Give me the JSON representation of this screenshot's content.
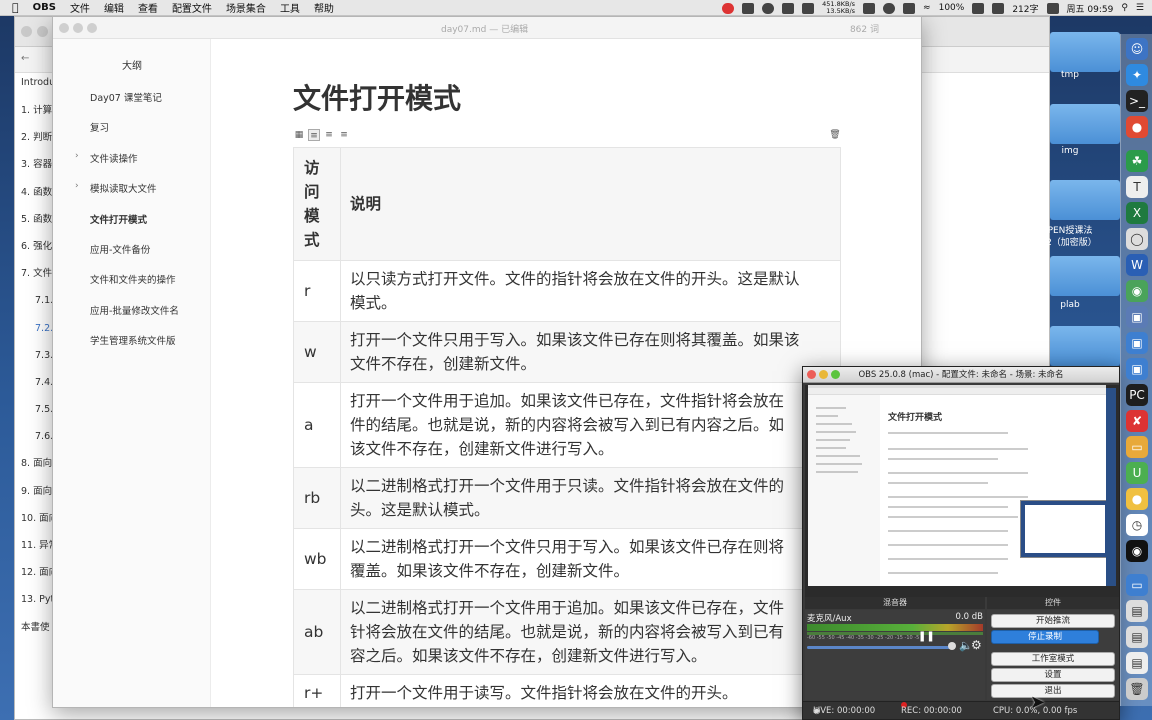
{
  "menubar": {
    "app_name": "OBS",
    "items": [
      "文件",
      "编辑",
      "查看",
      "配置文件",
      "场景集合",
      "工具",
      "帮助"
    ],
    "net_up": "451.8KB/s",
    "net_down": "13.5KB/s",
    "battery": "100%",
    "chars": "212字",
    "clock": "周五 09:59"
  },
  "back_window": {
    "intro": "Introdu",
    "nav": [
      {
        "label": "1. 计算",
        "sub": false,
        "active": false
      },
      {
        "label": "2. 判断",
        "sub": false,
        "active": false
      },
      {
        "label": "3. 容器",
        "sub": false,
        "active": false
      },
      {
        "label": "4. 函数",
        "sub": false,
        "active": false
      },
      {
        "label": "5. 函数",
        "sub": false,
        "active": false
      },
      {
        "label": "6. 强化",
        "sub": false,
        "active": false
      },
      {
        "label": "7. 文件",
        "sub": false,
        "active": false
      },
      {
        "label": "7.1.",
        "sub": true,
        "active": false
      },
      {
        "label": "7.2.",
        "sub": true,
        "active": true
      },
      {
        "label": "7.3.",
        "sub": true,
        "active": false
      },
      {
        "label": "7.4.",
        "sub": true,
        "active": false
      },
      {
        "label": "7.5.",
        "sub": true,
        "active": false
      },
      {
        "label": "7.6.",
        "sub": true,
        "active": false
      },
      {
        "label": "8. 面向",
        "sub": false,
        "active": false
      },
      {
        "label": "9. 面向",
        "sub": false,
        "active": false
      },
      {
        "label": "10. 面向",
        "sub": false,
        "active": false
      },
      {
        "label": "11. 异常",
        "sub": false,
        "active": false
      },
      {
        "label": "12. 面向",
        "sub": false,
        "active": false
      },
      {
        "label": "13. Pyt",
        "sub": false,
        "active": false
      },
      {
        "label": "本書使",
        "sub": false,
        "active": false
      }
    ]
  },
  "typora": {
    "doc_title": "day07.md — 已编辑",
    "word_count": "862 词",
    "outline_heading": "大纲",
    "outline": [
      {
        "label": "Day07 课堂笔记",
        "caret": false,
        "active": false
      },
      {
        "label": "复习",
        "caret": false,
        "active": false
      },
      {
        "label": "文件读操作",
        "caret": true,
        "active": false
      },
      {
        "label": "模拟读取大文件",
        "caret": true,
        "active": false
      },
      {
        "label": "文件打开模式",
        "caret": false,
        "active": true
      },
      {
        "label": "应用-文件备份",
        "caret": false,
        "active": false
      },
      {
        "label": "文件和文件夹的操作",
        "caret": false,
        "active": false
      },
      {
        "label": "应用-批量修改文件名",
        "caret": false,
        "active": false
      },
      {
        "label": "学生管理系统文件版",
        "caret": false,
        "active": false
      }
    ],
    "heading": "文件打开模式",
    "table_header": {
      "mode": "访问模式",
      "desc": "说明"
    },
    "rows": [
      {
        "mode": "r",
        "lines": [
          "以只读方式打开文件。文件的指针将会放在文件的开头。这是默认",
          "模式。"
        ]
      },
      {
        "mode": "w",
        "lines": [
          "打开一个文件只用于写入。如果该文件已存在则将其覆盖。如果该",
          "文件不存在，创建新文件。"
        ]
      },
      {
        "mode": "a",
        "lines": [
          "打开一个文件用于追加。如果该文件已存在，文件指针将会放在",
          "件的结尾。也就是说，新的内容将会被写入到已有内容之后。如",
          "该文件不存在，创建新文件进行写入。"
        ]
      },
      {
        "mode": "rb",
        "lines": [
          "以二进制格式打开一个文件用于只读。文件指针将会放在文件的",
          "头。这是默认模式。"
        ]
      },
      {
        "mode": "wb",
        "lines": [
          "以二进制格式打开一个文件只用于写入。如果该文件已存在则将",
          "覆盖。如果该文件不存在，创建新文件。"
        ]
      },
      {
        "mode": "ab",
        "lines": [
          "以二进制格式打开一个文件用于追加。如果该文件已存在，文件",
          "针将会放在文件的结尾。也就是说，新的内容将会被写入到已有",
          "容之后。如果该文件不存在，创建新文件进行写入。"
        ]
      },
      {
        "mode": "r+",
        "lines": [
          "打开一个文件用于读写。文件指针将会放在文件的开头。"
        ]
      }
    ]
  },
  "obs": {
    "title": "OBS 25.0.8 (mac) - 配置文件: 未命名 - 场景: 未命名",
    "preview_heading": "文件打开模式",
    "mixer_title": "混音器",
    "controls_title": "控件",
    "mixer_source": "麦克风/Aux",
    "mixer_db": "0.0 dB",
    "mixer_scale": "-60 -55 -50 -45 -40 -35 -30 -25 -20 -15 -10 -5 0",
    "volume_level": 0.98,
    "buttons": {
      "start_stream": "开始推流",
      "stop_recording": "停止录制",
      "studio_mode": "工作室模式",
      "settings": "设置",
      "exit": "退出"
    },
    "status": {
      "live": "LIVE: 00:00:00",
      "rec": "REC: 00:00:00",
      "cpu": "CPU: 0.0%, 0.00 fps"
    }
  },
  "desktop": {
    "folders": [
      "tmp",
      "img",
      "PEN授课法",
      ".2（加密版）",
      "plab"
    ]
  },
  "colors": {
    "obs_accent": "#2e7fdb",
    "outline_active": "#3b73c7",
    "record_red": "#d22"
  }
}
